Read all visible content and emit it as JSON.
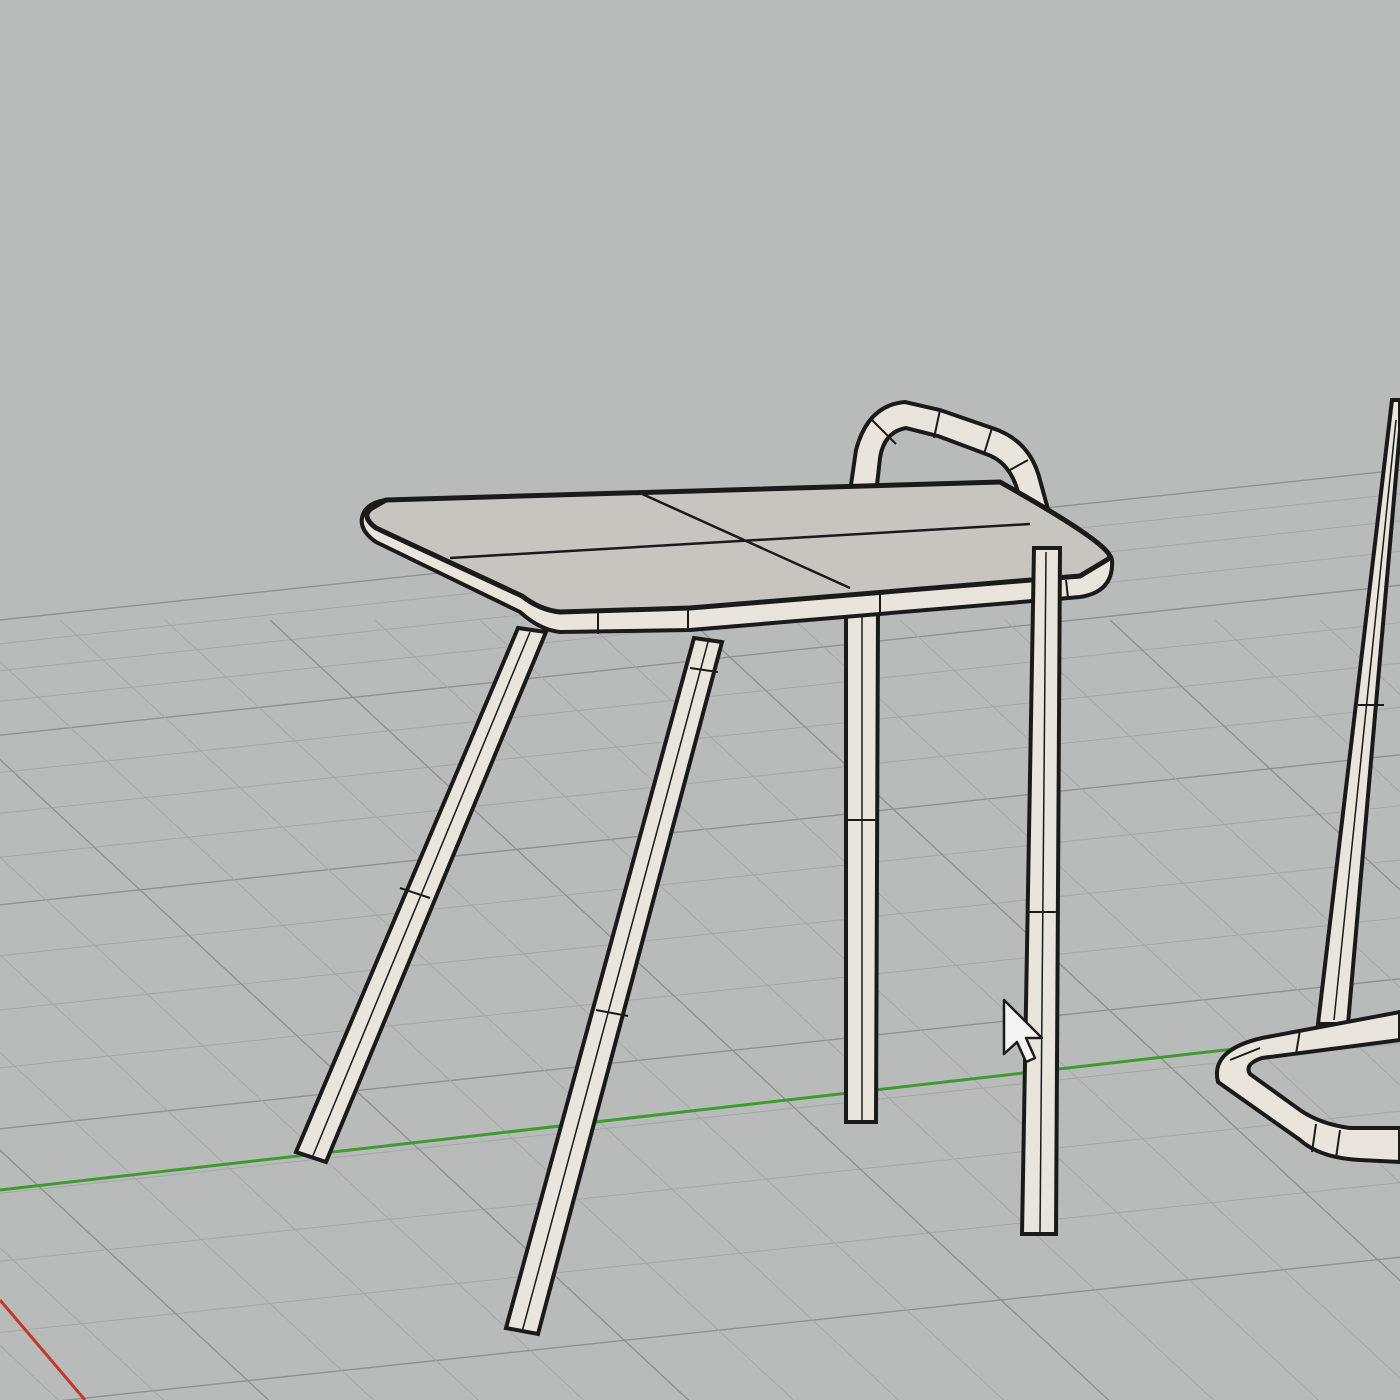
{
  "viewport": {
    "kind": "3d-perspective-viewport",
    "display_mode": "wireframe-shaded",
    "background_color": "#b9bbbb",
    "grid_minor_color": "#a5a8a8",
    "grid_major_color": "#8f9292",
    "x_axis_color": "#c0392b",
    "y_axis_color": "#3f9b2f",
    "object_fill": "#e9e5dd",
    "object_outline": "#1a1a1a",
    "tabletop_fill": "#c7c5bf"
  },
  "objects": [
    {
      "name": "side-table-model",
      "parts": [
        "tabletop",
        "leg-front-left",
        "leg-front-right",
        "leg-back-left",
        "handle-frame"
      ]
    },
    {
      "name": "adjacent-frame-model",
      "parts": [
        "vertical-post",
        "base-loop"
      ]
    }
  ],
  "cursor": {
    "icon": "arrow-pointer-icon"
  }
}
